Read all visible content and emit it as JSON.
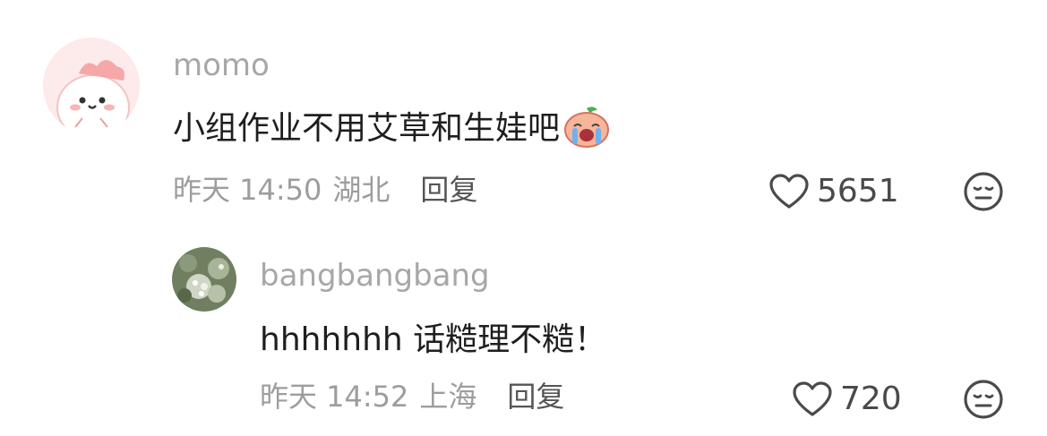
{
  "comments": [
    {
      "username": "momo",
      "text": "小组作业不用艾草和生娃吧",
      "emoji": "crying-peach-emoji",
      "time": "昨天 14:50",
      "location": "湖北",
      "reply_label": "回复",
      "likes": "5651",
      "avatar": "pink-cartoon-avatar"
    },
    {
      "username": "bangbangbang",
      "text": "hhhhhhh 话糙理不糙！",
      "time": "昨天 14:52",
      "location": "上海",
      "reply_label": "回复",
      "likes": "720",
      "avatar": "flower-photo-avatar"
    }
  ],
  "icons": {
    "like": "heart-outline-icon",
    "dislike": "meh-face-icon"
  },
  "colors": {
    "username": "#a7a7a7",
    "text": "#1e1e1e",
    "meta": "#9d9d9d",
    "reply": "#555555",
    "avatar_pink": "#fde6e6"
  }
}
